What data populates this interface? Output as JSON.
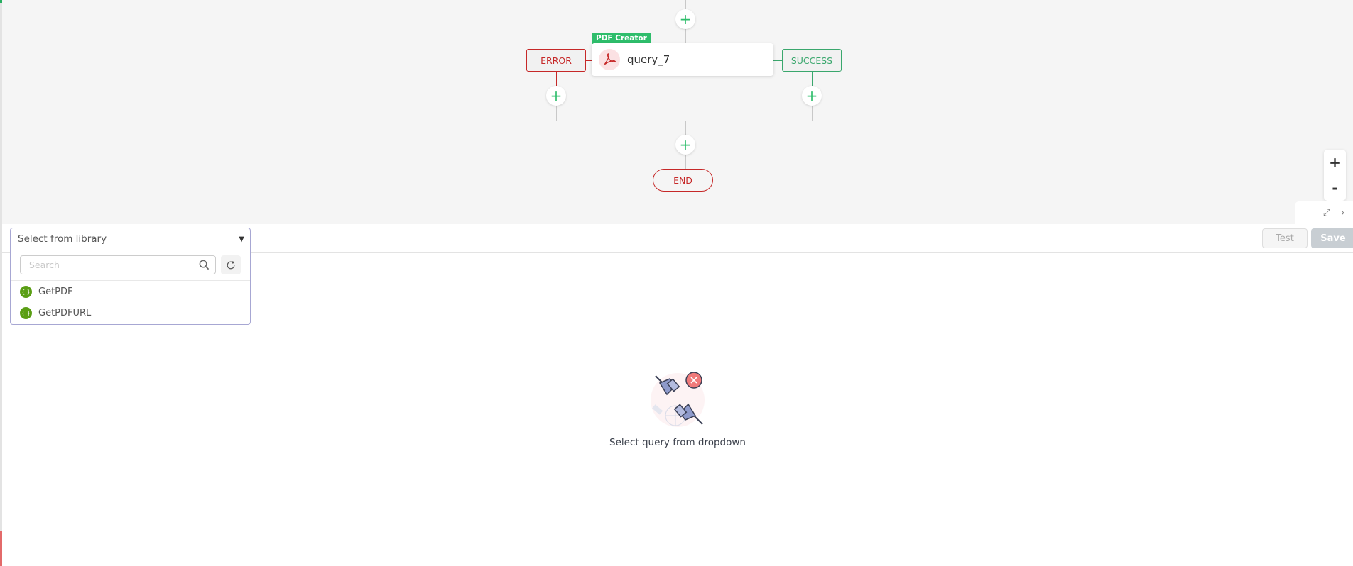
{
  "flow": {
    "node": {
      "type_tag": "PDF Creator",
      "title": "query_7",
      "icon": "acrobat-pdf-icon"
    },
    "branches": {
      "error_label": "ERROR",
      "success_label": "SUCCESS"
    },
    "end_label": "END",
    "add_symbol": "+",
    "colors": {
      "accent_green": "#2ebd6b",
      "error_red": "#c62828",
      "success_green": "#3aa76d"
    }
  },
  "zoom_controls": {
    "zoom_in": "+",
    "zoom_out": "-"
  },
  "panel_controls": {
    "minimize": "—",
    "expand": "⤢",
    "collapse": "›"
  },
  "toolbar": {
    "test_label": "Test",
    "save_label": "Save"
  },
  "library": {
    "select_label": "Select from library",
    "search_placeholder": "Search",
    "search_value": "",
    "items": [
      {
        "label": "GetPDF",
        "icon": "api-braces-icon"
      },
      {
        "label": "GetPDFURL",
        "icon": "api-braces-icon"
      }
    ]
  },
  "empty_state": {
    "message": "Select query from dropdown",
    "illustration": "disconnected-plugs-illustration"
  }
}
